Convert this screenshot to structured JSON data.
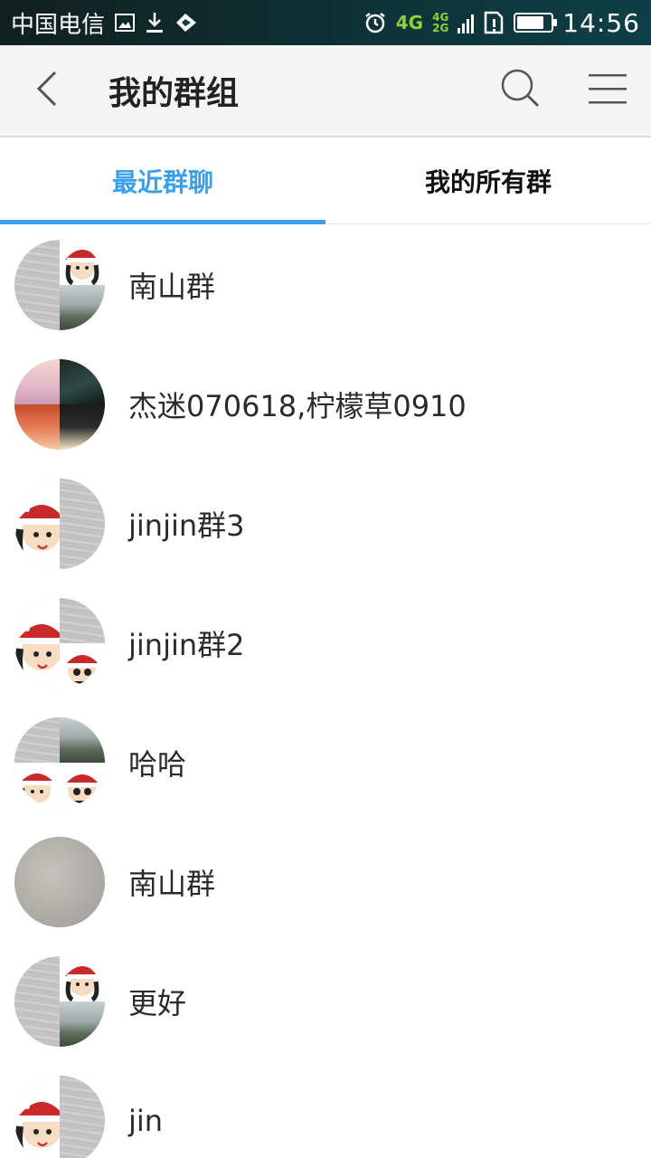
{
  "status_bar": {
    "carrier": "中国电信",
    "network_primary": "4G",
    "network_secondary": [
      "4G",
      "2G"
    ],
    "battery_level": 0.8,
    "time": "14:56",
    "icons": [
      "gallery-icon",
      "download-icon",
      "signal-boost-icon",
      "alarm-icon",
      "sim-alert-icon"
    ]
  },
  "header": {
    "title": "我的群组",
    "icons": {
      "back": "back-arrow-icon",
      "search": "search-icon",
      "menu": "menu-icon"
    }
  },
  "tabs": [
    {
      "label": "最近群聊",
      "active": true
    },
    {
      "label": "我的所有群",
      "active": false
    }
  ],
  "groups": [
    {
      "name": "南山群"
    },
    {
      "name": "杰迷070618,柠檬草0910"
    },
    {
      "name": "jinjin群3"
    },
    {
      "name": "jinjin群2"
    },
    {
      "name": "哈哈"
    },
    {
      "name": "南山群"
    },
    {
      "name": "更好"
    },
    {
      "name": "jin"
    }
  ],
  "colors": {
    "accent": "#3aa0e8",
    "status_bar": "#0d3f48",
    "app_bar": "#f4f4f4",
    "network": "#8bd33c"
  }
}
